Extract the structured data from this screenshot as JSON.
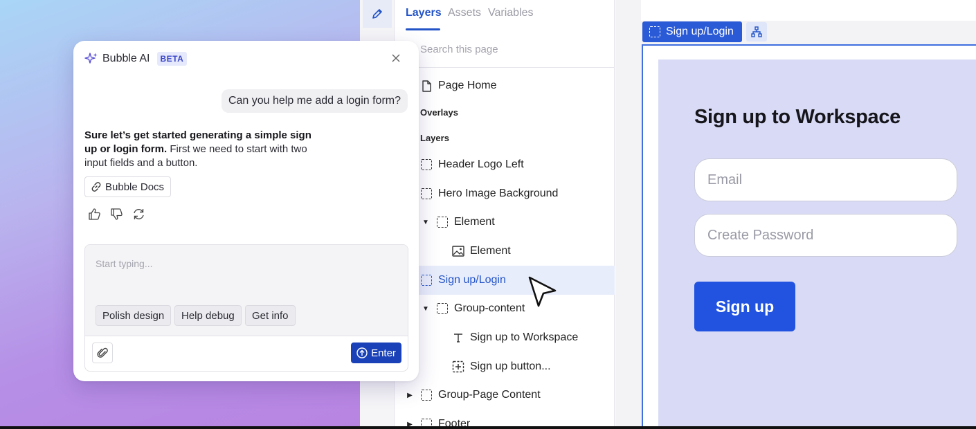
{
  "layers_panel": {
    "tabs": [
      {
        "label": "Layers",
        "active": true
      },
      {
        "label": "Assets",
        "active": false
      },
      {
        "label": "Variables",
        "active": false
      }
    ],
    "search_placeholder": "Search this page",
    "page_item": "Page Home",
    "sections": {
      "overlays": "Overlays",
      "layers": "Layers"
    },
    "items": [
      {
        "label": "Header Logo Left",
        "icon": "group-icon",
        "indent": 0
      },
      {
        "label": "Hero Image Background",
        "icon": "group-icon",
        "indent": 0
      },
      {
        "label": "Element",
        "icon": "group-icon",
        "indent": 1,
        "expanded": true
      },
      {
        "label": "Element",
        "icon": "image-icon",
        "indent": 2
      },
      {
        "label": "Sign up/Login",
        "icon": "group-icon",
        "indent": 0,
        "selected": true
      },
      {
        "label": "Group-content",
        "icon": "group-icon",
        "indent": 1,
        "expanded": true
      },
      {
        "label": "Sign up to Workspace",
        "icon": "text-icon",
        "indent": 2
      },
      {
        "label": "Sign up button...",
        "icon": "button-icon",
        "indent": 2
      },
      {
        "label": "Group-Page Content",
        "icon": "group-icon",
        "indent": 0,
        "collapsed": true
      },
      {
        "label": "Footer",
        "icon": "group-icon",
        "indent": 0,
        "collapsed": true
      }
    ]
  },
  "canvas": {
    "selection_tag": "Sign up/Login",
    "form": {
      "title": "Sign up to Workspace",
      "email_placeholder": "Email",
      "password_placeholder": "Create Password",
      "button_label": "Sign up"
    }
  },
  "chat": {
    "title": "Bubble AI",
    "badge": "BETA",
    "user_message": "Can you help me add a login form?",
    "ai_message_bold": "Sure let’s get started generating a simple sign up or login form.",
    "ai_message_rest": " First we need to start with two input fields and a button.",
    "docs_chip": "Bubble Docs",
    "composer_placeholder": "Start typing...",
    "quick_actions": [
      "Polish design",
      "Help debug",
      "Get info"
    ],
    "enter_label": "Enter"
  },
  "colors": {
    "accent": "#2253c7",
    "canvas_frame": "#d9dbf6",
    "signup_button": "#2153e0",
    "enter_button": "#1a41b8"
  }
}
